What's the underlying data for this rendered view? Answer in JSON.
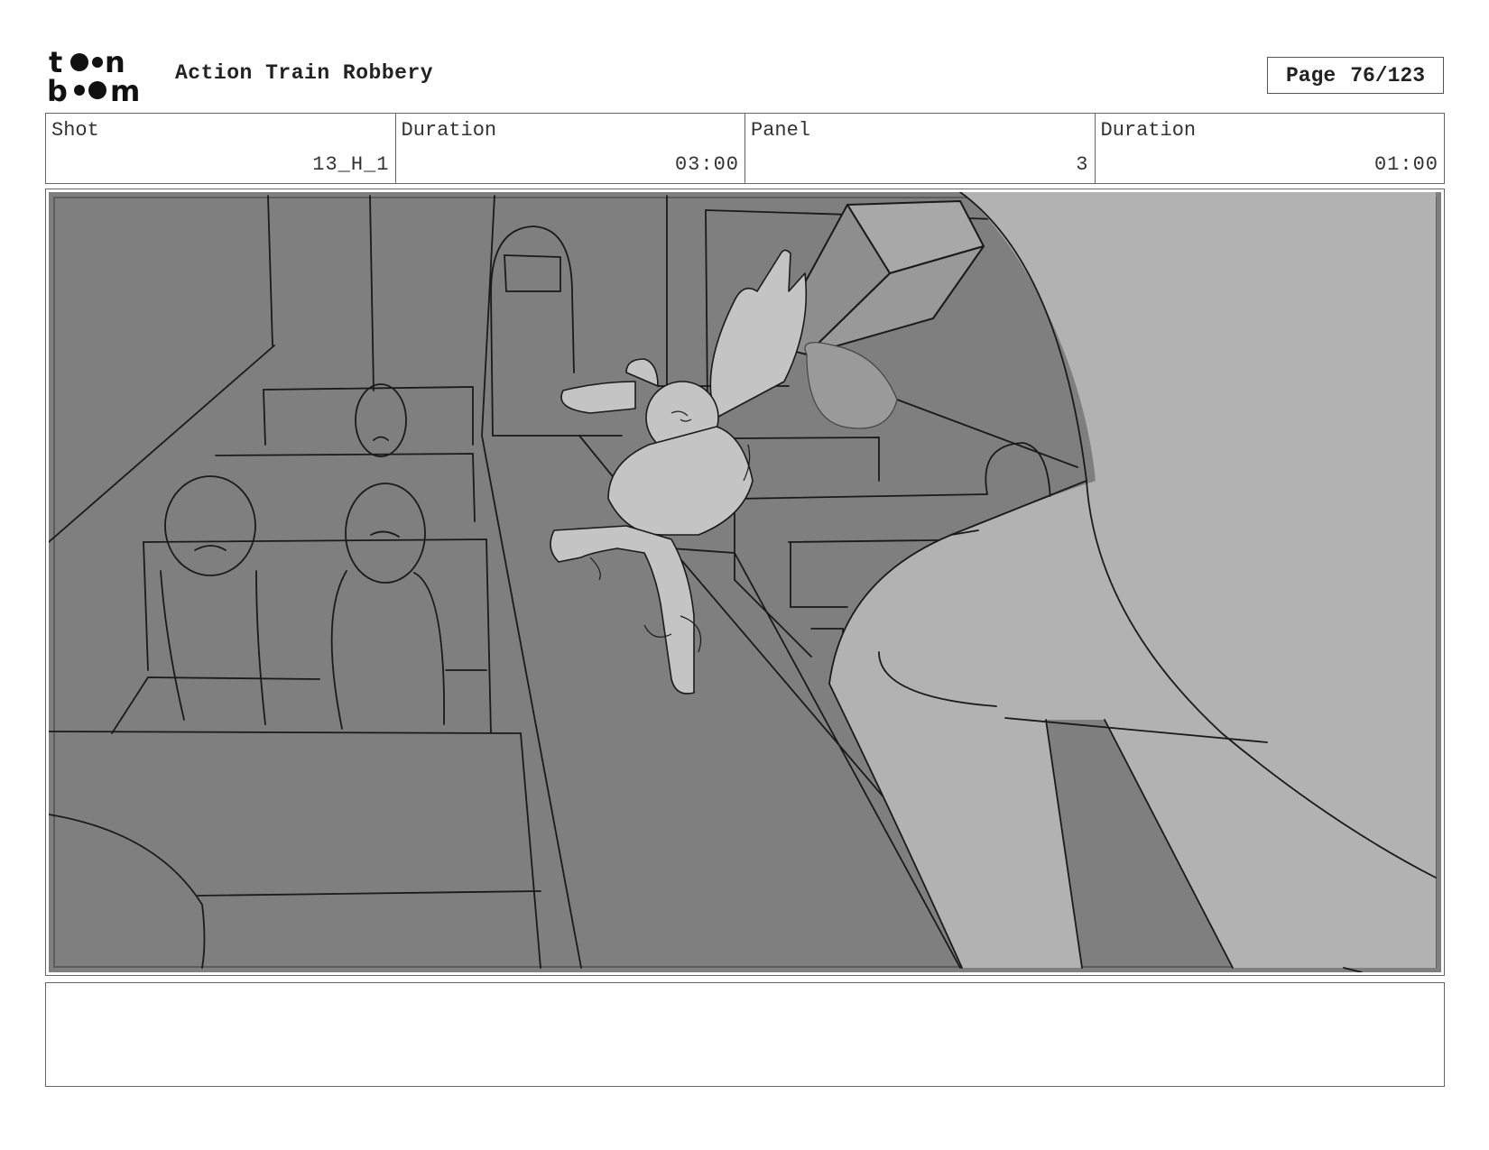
{
  "header": {
    "project_title": "Action Train Robbery",
    "page_label": "Page",
    "page_value": "76/123",
    "logo_text": "toon boom"
  },
  "shot_info": {
    "shot_label": "Shot",
    "shot_value": "13_H_1",
    "shot_duration_label": "Duration",
    "shot_duration_value": "03:00",
    "panel_label": "Panel",
    "panel_value": "3",
    "panel_duration_label": "Duration",
    "panel_duration_value": "01:00"
  },
  "colors": {
    "background_gray": "#7f7f7f",
    "foreground_gray": "#b2b2b2",
    "character_gray": "#c4c4c4",
    "line": "#1a1a1a"
  },
  "notes": ""
}
